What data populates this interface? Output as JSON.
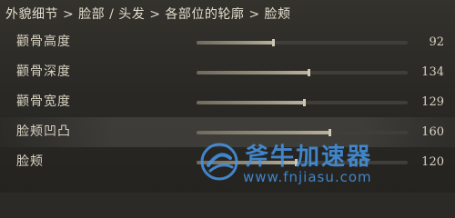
{
  "breadcrumb": "外貌细节 > 脸部 / 头发 > 各部位的轮廓 > 脸颊",
  "sliders": [
    {
      "label": "颧骨高度",
      "value": "92",
      "level": 0.36
    },
    {
      "label": "颧骨深度",
      "value": "134",
      "level": 0.53
    },
    {
      "label": "颧骨宽度",
      "value": "129",
      "level": 0.51
    },
    {
      "label": "脸颊凹凸",
      "value": "160",
      "level": 0.63
    },
    {
      "label": "脸颊",
      "value": "120",
      "level": 0.47
    }
  ],
  "selected_index": 3,
  "watermark": {
    "title": "斧牛加速器",
    "url": "www.fnjiasu.com",
    "color": "#4696e6"
  }
}
